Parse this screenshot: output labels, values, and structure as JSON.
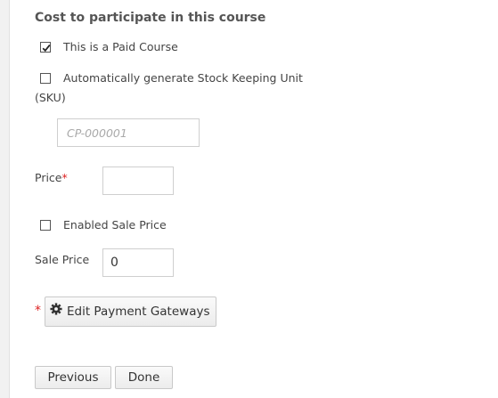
{
  "section": {
    "heading": "Cost to participate in this course"
  },
  "paid_course": {
    "label": "This is a Paid Course",
    "checked": true
  },
  "sku_auto": {
    "label_line1": "Automatically generate Stock Keeping Unit",
    "label_line2": "(SKU)",
    "checked": false
  },
  "sku_input": {
    "placeholder": "CP-000001",
    "value": ""
  },
  "price": {
    "label": "Price",
    "required_marker": "*",
    "value": ""
  },
  "sale_enabled": {
    "label": "Enabled Sale Price",
    "checked": false
  },
  "sale_price": {
    "label": "Sale Price",
    "value": "0"
  },
  "gateways": {
    "required_marker": "*",
    "button_label": "Edit Payment Gateways",
    "icon": "gear-icon"
  },
  "navigation": {
    "previous_label": "Previous",
    "done_label": "Done"
  },
  "colors": {
    "required": "#dd2222",
    "panel_background": "#ffffff",
    "page_background": "#f1f1f1"
  }
}
